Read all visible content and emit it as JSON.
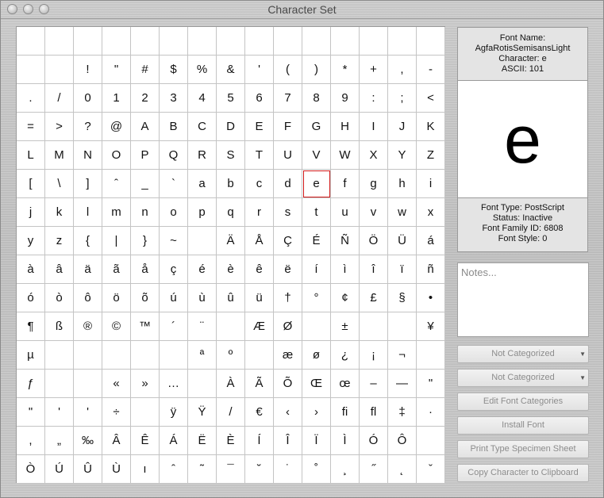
{
  "window": {
    "title": "Character Set"
  },
  "grid": {
    "rows": [
      [
        "",
        "",
        "",
        "",
        "",
        "",
        "",
        "",
        "",
        "",
        "",
        "",
        "",
        "",
        ""
      ],
      [
        "",
        "",
        "!",
        "\"",
        "#",
        "$",
        "%",
        "&",
        "'",
        "(",
        ")",
        "*",
        "+",
        ",",
        "-"
      ],
      [
        ".",
        "/",
        "0",
        "1",
        "2",
        "3",
        "4",
        "5",
        "6",
        "7",
        "8",
        "9",
        ":",
        ";",
        "<"
      ],
      [
        "=",
        ">",
        "?",
        "@",
        "A",
        "B",
        "C",
        "D",
        "E",
        "F",
        "G",
        "H",
        "I",
        "J",
        "K"
      ],
      [
        "L",
        "M",
        "N",
        "O",
        "P",
        "Q",
        "R",
        "S",
        "T",
        "U",
        "V",
        "W",
        "X",
        "Y",
        "Z"
      ],
      [
        "[",
        "\\",
        "]",
        "ˆ",
        "_",
        "`",
        "a",
        "b",
        "c",
        "d",
        "e",
        "f",
        "g",
        "h",
        "i"
      ],
      [
        "j",
        "k",
        "l",
        "m",
        "n",
        "o",
        "p",
        "q",
        "r",
        "s",
        "t",
        "u",
        "v",
        "w",
        "x"
      ],
      [
        "y",
        "z",
        "{",
        "|",
        "}",
        "~",
        "",
        "Ä",
        "Å",
        "Ç",
        "É",
        "Ñ",
        "Ö",
        "Ü",
        "á"
      ],
      [
        "à",
        "â",
        "ä",
        "ã",
        "å",
        "ç",
        "é",
        "è",
        "ê",
        "ë",
        "í",
        "ì",
        "î",
        "ï",
        "ñ"
      ],
      [
        "ó",
        "ò",
        "ô",
        "ö",
        "õ",
        "ú",
        "ù",
        "û",
        "ü",
        "†",
        "°",
        "¢",
        "£",
        "§",
        "•"
      ],
      [
        "¶",
        "ß",
        "®",
        "©",
        "™",
        "´",
        "¨",
        "",
        "Æ",
        "Ø",
        "",
        "±",
        "",
        "",
        "¥"
      ],
      [
        "µ",
        "",
        "",
        "",
        "",
        "",
        "ª",
        "º",
        "",
        "æ",
        "ø",
        "¿",
        "¡",
        "¬",
        ""
      ],
      [
        "ƒ",
        "",
        "",
        "«",
        "»",
        "…",
        "",
        "À",
        "Ã",
        "Õ",
        "Œ",
        "œ",
        "–",
        "—",
        "\""
      ],
      [
        "\"",
        "'",
        "'",
        "÷",
        "",
        "ÿ",
        "Ÿ",
        "/",
        "€",
        "‹",
        "›",
        "ﬁ",
        "ﬂ",
        "‡",
        "·"
      ],
      [
        ",",
        "„",
        "‰",
        "Â",
        "Ê",
        "Á",
        "Ë",
        "È",
        "Í",
        "Î",
        "Ï",
        "Ì",
        "Ó",
        "Ô",
        ""
      ],
      [
        "Ò",
        "Ú",
        "Û",
        "Ù",
        "ı",
        "ˆ",
        "˜",
        "¯",
        "˘",
        "˙",
        "˚",
        "¸",
        "˝",
        "˛",
        "ˇ"
      ]
    ],
    "selected": {
      "row": 5,
      "col": 10
    }
  },
  "info": {
    "font_name_label": "Font Name:",
    "font_name": "AgfaRotisSemisansLight",
    "character": "Character: e",
    "ascii": "ASCII: 101",
    "preview_char": "e",
    "font_type": "Font Type: PostScript",
    "status": "Status: Inactive",
    "family_id": "Font Family ID: 6808",
    "font_style": "Font Style: 0"
  },
  "notes": {
    "placeholder": "Notes..."
  },
  "controls": {
    "category_1": "Not Categorized",
    "category_2": "Not Categorized",
    "edit_categories": "Edit Font Categories",
    "install_font": "Install Font",
    "print_specimen": "Print Type Specimen Sheet",
    "copy_character": "Copy Character to Clipboard"
  }
}
